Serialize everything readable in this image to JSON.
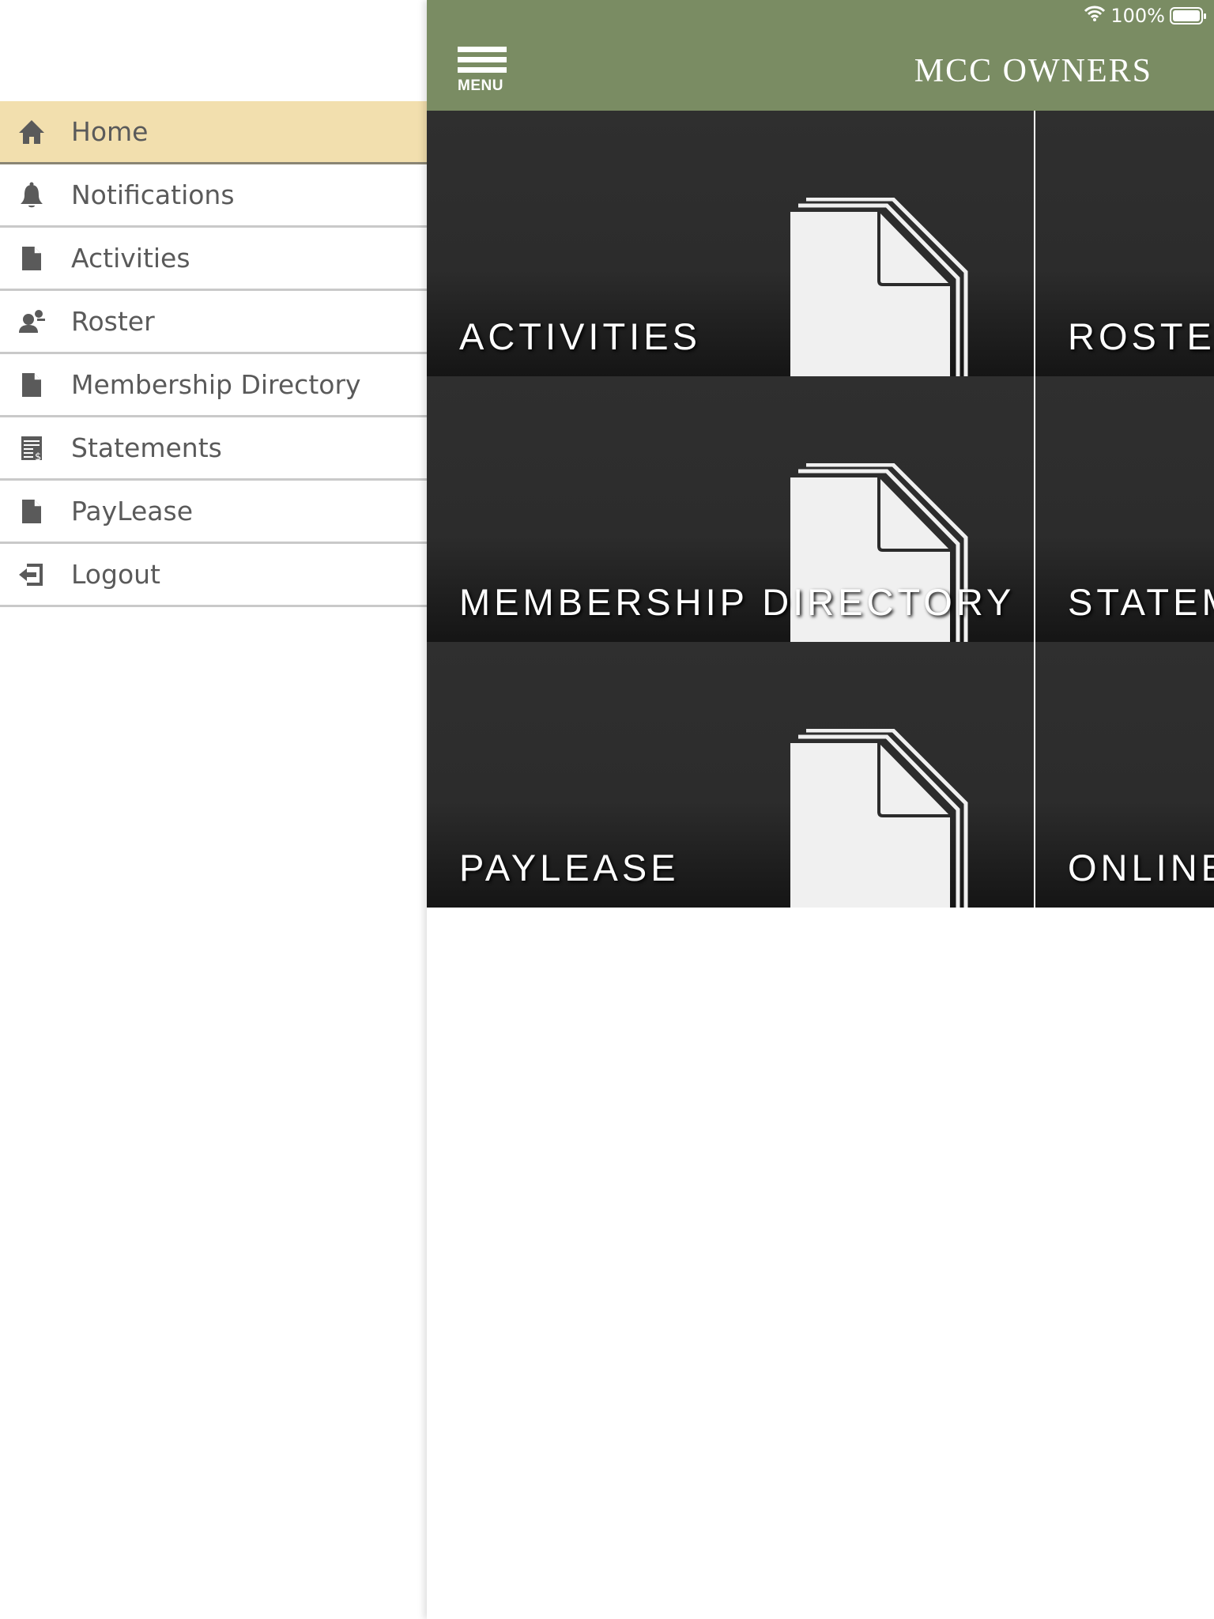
{
  "status_bar": {
    "battery": "100%",
    "wifi_icon": "wifi-icon",
    "battery_level_percent": 100
  },
  "header": {
    "menu_label": "MENU",
    "title": "MCC OWNERS",
    "color": "#7a8c63"
  },
  "sidebar": {
    "active_color": "#f2dfae",
    "items": [
      {
        "label": "Home",
        "icon": "home-icon",
        "active": true
      },
      {
        "label": "Notifications",
        "icon": "bell-icon"
      },
      {
        "label": "Activities",
        "icon": "document-icon"
      },
      {
        "label": "Roster",
        "icon": "people-icon"
      },
      {
        "label": "Membership Directory",
        "icon": "document-icon"
      },
      {
        "label": "Statements",
        "icon": "statement-icon"
      },
      {
        "label": "PayLease",
        "icon": "document-icon"
      },
      {
        "label": "Logout",
        "icon": "logout-icon"
      }
    ]
  },
  "tiles": [
    {
      "label": "ACTIVITIES"
    },
    {
      "label": "ROSTER"
    },
    {
      "label": "MEMBERSHIP DIRECTORY"
    },
    {
      "label": "STATEMENTS"
    },
    {
      "label": "PAYLEASE"
    },
    {
      "label": "ONLINE"
    }
  ]
}
